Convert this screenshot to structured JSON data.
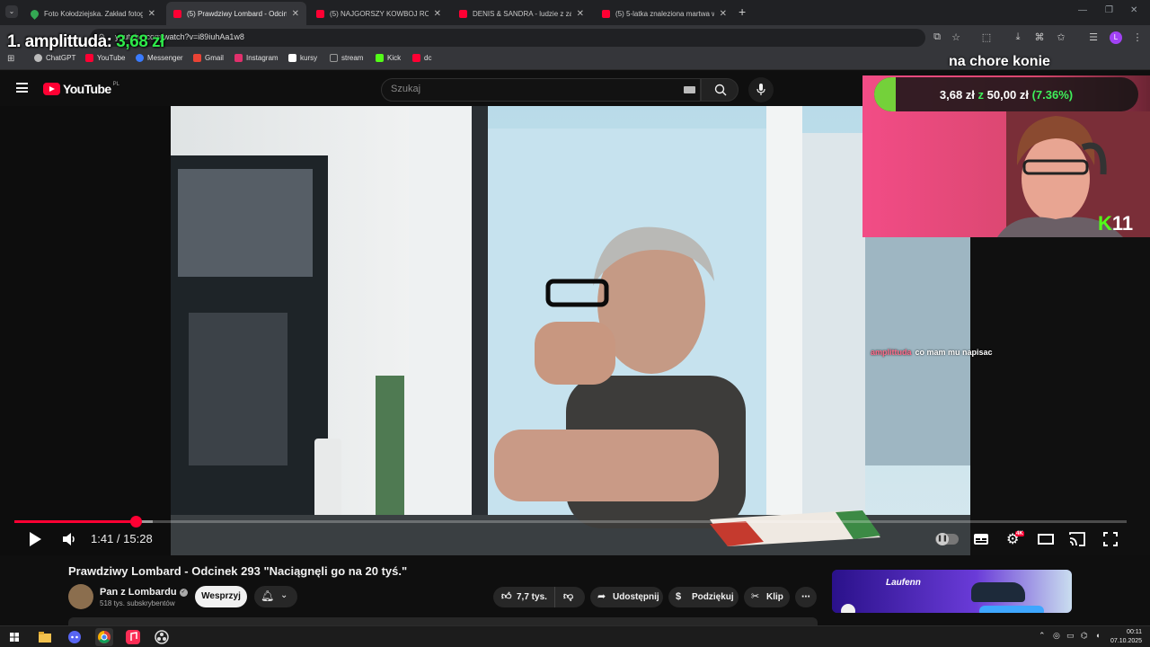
{
  "browser": {
    "tabs": [
      {
        "title": "Foto Kołodziejska. Zakład fotog",
        "active": false,
        "favicon": "maps-pin-icon"
      },
      {
        "title": "(5) Prawdziwy Lombard - Odcin",
        "active": true,
        "favicon": "youtube-icon"
      },
      {
        "title": "(5) NAJGORSZY KOWBOJ ROBI",
        "active": false,
        "favicon": "youtube-icon"
      },
      {
        "title": "DENIS & SANDRA - ludzie z zał",
        "active": false,
        "favicon": "youtube-icon"
      },
      {
        "title": "(5) 5-latka znaleziona martwa w",
        "active": false,
        "favicon": "youtube-icon"
      }
    ],
    "url": "youtube.com/watch?v=i89iuhAa1w8",
    "profile_initial": "L",
    "bookmarks": [
      {
        "label": "ChatGPT",
        "color": "#bbbbbb"
      },
      {
        "label": "YouTube",
        "color": "#ff0033"
      },
      {
        "label": "Messenger",
        "color": "#3a7bff"
      },
      {
        "label": "Gmail",
        "color": "#ea4335"
      },
      {
        "label": "Instagram",
        "color": "#e1306c"
      },
      {
        "label": "kursy",
        "color": "#ffffff"
      },
      {
        "label": "stream",
        "color": "#999999"
      },
      {
        "label": "Kick",
        "color": "#53fc18"
      },
      {
        "label": "dc",
        "color": "#ff0033"
      }
    ]
  },
  "overlay": {
    "top_donor_label": "1. amplittuda:",
    "top_donor_value": "3,68 zł",
    "goal_title": "na chore konie",
    "goal_current": "3,68 zł",
    "goal_sep": "z",
    "goal_target": "50,00 zł",
    "goal_percent": "(7.36%)",
    "goal_fraction": 0.0736,
    "kick_viewers": "11",
    "chat_user": "amplittuda",
    "chat_message": "co mam mu napisac"
  },
  "youtube": {
    "logo": "YouTube",
    "logo_region": "PL",
    "search_placeholder": "Szukaj",
    "video_title": "Prawdziwy Lombard - Odcinek 293 \"Naciągnęli go na 20 tyś.\"",
    "channel_name": "Pan z Lombardu",
    "subscribers": "518 tys. subskrybentów",
    "support_label": "Wesprzyj",
    "likes": "7,7 tys.",
    "share_label": "Udostępnij",
    "thanks_label": "Podziękuj",
    "clip_label": "Klip",
    "ad_brand": "Laufenn",
    "player": {
      "current_time": "1:41",
      "duration": "15:28",
      "time_display": "1:41 / 15:28",
      "progress": 0.109,
      "buffered": 0.124,
      "quality_badge": "4K"
    }
  },
  "taskbar": {
    "time": "00:11",
    "date": "07.10.2025"
  }
}
